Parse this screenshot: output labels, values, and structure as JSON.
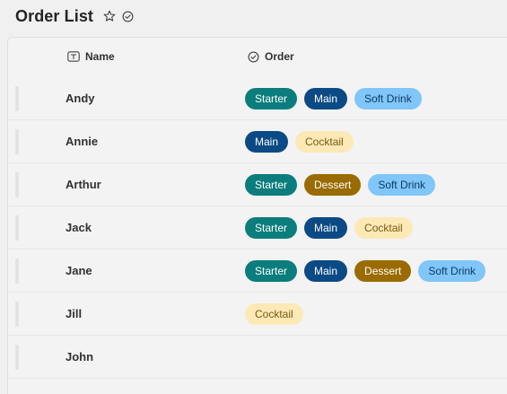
{
  "header": {
    "title": "Order List"
  },
  "columns": {
    "name": "Name",
    "order": "Order"
  },
  "tag_styles": {
    "Starter": {
      "bg": "#0b7d7d",
      "fg": "#ffffff"
    },
    "Main": {
      "bg": "#0b4a85",
      "fg": "#ffffff"
    },
    "Dessert": {
      "bg": "#9a6b00",
      "fg": "#ffffff"
    },
    "Soft Drink": {
      "bg": "#80c6f8",
      "fg": "#0d3a66"
    },
    "Cocktail": {
      "bg": "#fce9b6",
      "fg": "#7a5a10"
    }
  },
  "rows": [
    {
      "name": "Andy",
      "order": [
        "Starter",
        "Main",
        "Soft Drink"
      ]
    },
    {
      "name": "Annie",
      "order": [
        "Main",
        "Cocktail"
      ]
    },
    {
      "name": "Arthur",
      "order": [
        "Starter",
        "Dessert",
        "Soft Drink"
      ]
    },
    {
      "name": "Jack",
      "order": [
        "Starter",
        "Main",
        "Cocktail"
      ]
    },
    {
      "name": "Jane",
      "order": [
        "Starter",
        "Main",
        "Dessert",
        "Soft Drink"
      ]
    },
    {
      "name": "Jill",
      "order": [
        "Cocktail"
      ]
    },
    {
      "name": "John",
      "order": []
    }
  ]
}
